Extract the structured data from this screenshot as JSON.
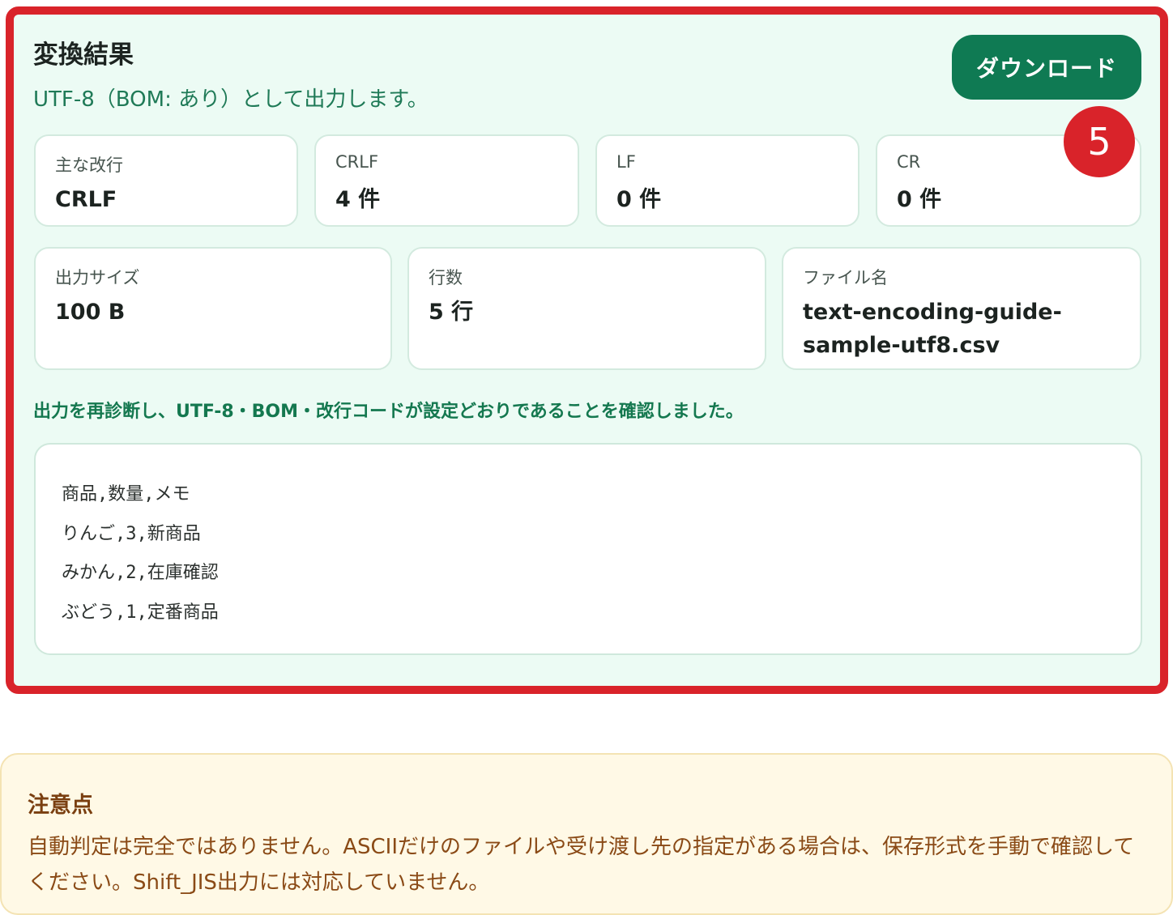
{
  "result": {
    "title": "変換結果",
    "subtitle": "UTF-8（BOM: あり）として出力します。",
    "download_label": "ダウンロード",
    "step_badge": "5",
    "stats_row1": [
      {
        "label": "主な改行",
        "value": "CRLF"
      },
      {
        "label": "CRLF",
        "value": "4 件"
      },
      {
        "label": "LF",
        "value": "0 件"
      },
      {
        "label": "CR",
        "value": "0 件"
      }
    ],
    "stats_row2": [
      {
        "label": "出力サイズ",
        "value": "100 B"
      },
      {
        "label": "行数",
        "value": "5 行"
      },
      {
        "label": "ファイル名",
        "value": "text-encoding-guide-sample-utf8.csv"
      }
    ],
    "verify_note": "出力を再診断し、UTF-8・BOM・改行コードが設定どおりであることを確認しました。",
    "preview_lines": [
      "商品,数量,メモ",
      "りんご,3,新商品",
      "みかん,2,在庫確認",
      "ぶどう,1,定番商品"
    ]
  },
  "notice": {
    "title": "注意点",
    "text": "自動判定は完全ではありません。ASCIIだけのファイルや受け渡し先の指定がある場合は、保存形式を手動で確認してください。Shift_JIS出力には対応していません。"
  },
  "colors": {
    "highlight_border": "#d9232a",
    "primary_green": "#0f7a53",
    "panel_bg": "#ecfbf4",
    "notice_bg": "#fff9e6"
  }
}
